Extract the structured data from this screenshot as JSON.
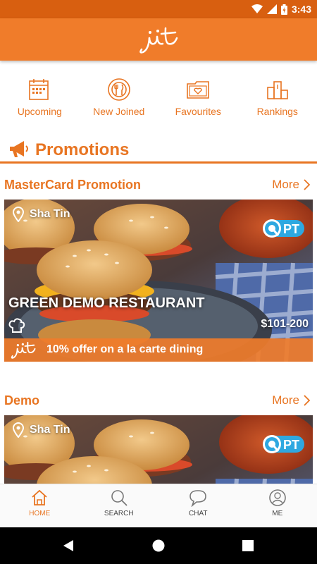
{
  "status_bar": {
    "time": "3:43",
    "icons": [
      "wifi-icon",
      "signal-icon",
      "battery-icon"
    ]
  },
  "app_bar": {
    "logo_text": "jit"
  },
  "quick_nav": [
    {
      "label": "Upcoming",
      "icon": "calendar-icon"
    },
    {
      "label": "New Joined",
      "icon": "plate-cutlery-icon"
    },
    {
      "label": "Favourites",
      "icon": "heart-folder-icon"
    },
    {
      "label": "Rankings",
      "icon": "podium-icon"
    }
  ],
  "promotions": {
    "title": "Promotions",
    "icon": "megaphone-icon"
  },
  "sections": [
    {
      "title": "MasterCard Promotion",
      "more_label": "More",
      "card": {
        "location": "Sha Tin",
        "badge": "PT",
        "restaurant": "GREEN DEMO RESTAURANT",
        "price": "$101-200",
        "offer_logo": "jit",
        "offer": "10% offer on a  la carte dining"
      }
    },
    {
      "title": "Demo",
      "more_label": "More",
      "card": {
        "location": "Sha Tin",
        "badge": "PT"
      }
    }
  ],
  "bottom_nav": [
    {
      "label": "HOME",
      "icon": "home-icon",
      "active": true
    },
    {
      "label": "SEARCH",
      "icon": "search-icon",
      "active": false
    },
    {
      "label": "CHAT",
      "icon": "chat-bubble-icon",
      "active": false
    },
    {
      "label": "ME",
      "icon": "user-icon",
      "active": false
    }
  ],
  "colors": {
    "brand": "#f07c2a",
    "brand_dark": "#d85f10",
    "accent_text": "#e87522"
  }
}
